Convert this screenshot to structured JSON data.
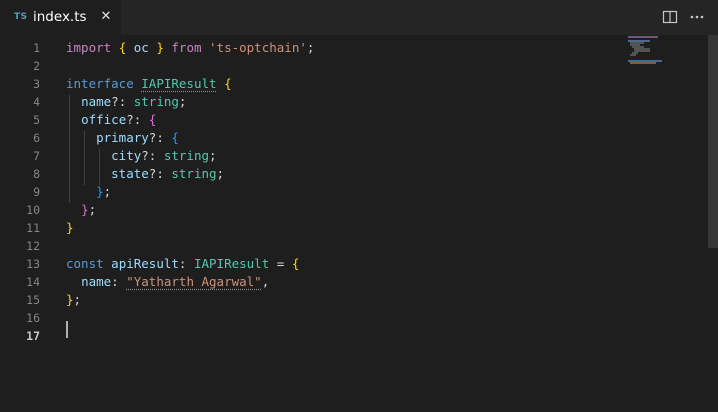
{
  "tab": {
    "lang_badge": "TS",
    "title": "index.ts",
    "close_glyph": "✕"
  },
  "actions": {
    "split": "split-editor-icon",
    "more": "more-actions-icon"
  },
  "editor": {
    "line_numbers": [
      "1",
      "2",
      "3",
      "4",
      "5",
      "6",
      "7",
      "8",
      "9",
      "10",
      "11",
      "12",
      "13",
      "14",
      "15",
      "16",
      "17"
    ],
    "active_line": "17",
    "lines": [
      [
        {
          "t": "import",
          "c": "kw"
        },
        {
          "t": " ",
          "c": "op"
        },
        {
          "t": "{",
          "c": "br1"
        },
        {
          "t": " oc ",
          "c": "pr"
        },
        {
          "t": "}",
          "c": "br1"
        },
        {
          "t": " ",
          "c": "op"
        },
        {
          "t": "from",
          "c": "kw"
        },
        {
          "t": " ",
          "c": "op"
        },
        {
          "t": "'ts-optchain'",
          "c": "st"
        },
        {
          "t": ";",
          "c": "op"
        }
      ],
      [],
      [
        {
          "t": "interface",
          "c": "kwb"
        },
        {
          "t": " ",
          "c": "op"
        },
        {
          "t": "IAPIResult",
          "c": "ty dotted"
        },
        {
          "t": " ",
          "c": "op"
        },
        {
          "t": "{",
          "c": "br1"
        }
      ],
      [
        {
          "t": "  ",
          "c": "op"
        },
        {
          "t": "name",
          "c": "pr"
        },
        {
          "t": "?: ",
          "c": "op"
        },
        {
          "t": "string",
          "c": "ty"
        },
        {
          "t": ";",
          "c": "op"
        }
      ],
      [
        {
          "t": "  ",
          "c": "op"
        },
        {
          "t": "office",
          "c": "pr"
        },
        {
          "t": "?: ",
          "c": "op"
        },
        {
          "t": "{",
          "c": "br2"
        }
      ],
      [
        {
          "t": "    ",
          "c": "op"
        },
        {
          "t": "primary",
          "c": "pr"
        },
        {
          "t": "?: ",
          "c": "op"
        },
        {
          "t": "{",
          "c": "br3"
        }
      ],
      [
        {
          "t": "      ",
          "c": "op"
        },
        {
          "t": "city",
          "c": "pr"
        },
        {
          "t": "?: ",
          "c": "op"
        },
        {
          "t": "string",
          "c": "ty"
        },
        {
          "t": ";",
          "c": "op"
        }
      ],
      [
        {
          "t": "      ",
          "c": "op"
        },
        {
          "t": "state",
          "c": "pr"
        },
        {
          "t": "?: ",
          "c": "op"
        },
        {
          "t": "string",
          "c": "ty"
        },
        {
          "t": ";",
          "c": "op"
        }
      ],
      [
        {
          "t": "    ",
          "c": "op"
        },
        {
          "t": "}",
          "c": "br3"
        },
        {
          "t": ";",
          "c": "op"
        }
      ],
      [
        {
          "t": "  ",
          "c": "op"
        },
        {
          "t": "}",
          "c": "br2"
        },
        {
          "t": ";",
          "c": "op"
        }
      ],
      [
        {
          "t": "}",
          "c": "br1"
        }
      ],
      [],
      [
        {
          "t": "const",
          "c": "kwb"
        },
        {
          "t": " ",
          "c": "op"
        },
        {
          "t": "apiResult",
          "c": "pr"
        },
        {
          "t": ": ",
          "c": "op"
        },
        {
          "t": "IAPIResult",
          "c": "ty"
        },
        {
          "t": " = ",
          "c": "op"
        },
        {
          "t": "{",
          "c": "br1"
        }
      ],
      [
        {
          "t": "  ",
          "c": "op"
        },
        {
          "t": "name",
          "c": "pr"
        },
        {
          "t": ": ",
          "c": "op"
        },
        {
          "t": "\"Yatharth Agarwal\"",
          "c": "st dotted"
        },
        {
          "t": ",",
          "c": "op"
        }
      ],
      [
        {
          "t": "}",
          "c": "br1"
        },
        {
          "t": ";",
          "c": "op"
        }
      ],
      [],
      []
    ]
  }
}
